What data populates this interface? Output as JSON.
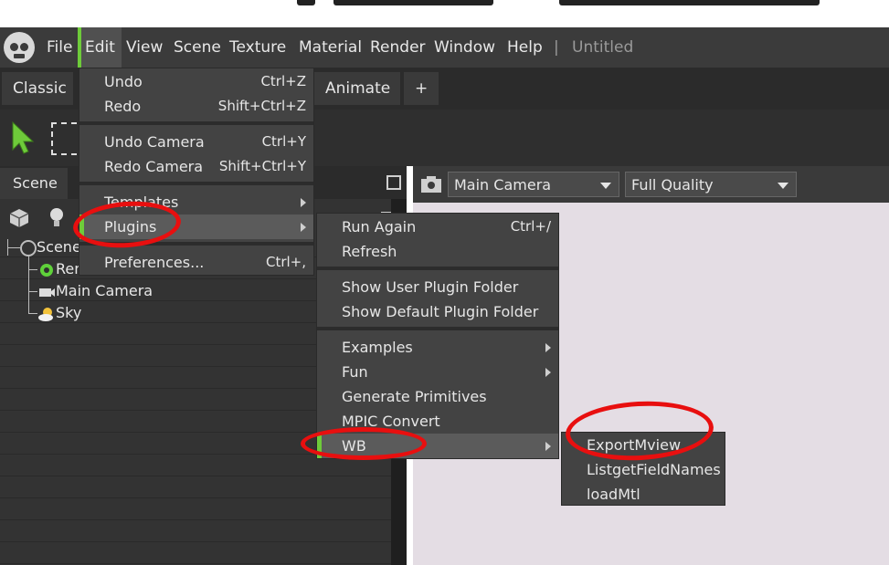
{
  "menubar": {
    "items": [
      "File",
      "Edit",
      "View",
      "Scene",
      "Texture",
      "Material",
      "Render",
      "Window",
      "Help"
    ],
    "separator": "|",
    "document_title": "Untitled"
  },
  "tabs": {
    "classic": "Classic",
    "animate": "Animate",
    "add": "+"
  },
  "scene_panel": {
    "tab": "Scene",
    "tree": [
      "Scene",
      "Render",
      "Main Camera",
      "Sky"
    ]
  },
  "viewport": {
    "camera": "Main Camera",
    "quality": "Full Quality"
  },
  "edit_menu": {
    "items": [
      {
        "label": "Undo",
        "shortcut": "Ctrl+Z"
      },
      {
        "label": "Redo",
        "shortcut": "Shift+Ctrl+Z"
      },
      {
        "label": "Undo Camera",
        "shortcut": "Ctrl+Y"
      },
      {
        "label": "Redo Camera",
        "shortcut": "Shift+Ctrl+Y"
      },
      {
        "label": "Templates",
        "shortcut": ""
      },
      {
        "label": "Plugins",
        "shortcut": ""
      },
      {
        "label": "Preferences...",
        "shortcut": "Ctrl+,"
      }
    ]
  },
  "plugins_menu": {
    "items": [
      {
        "label": "Run Again",
        "shortcut": "Ctrl+/"
      },
      {
        "label": "Refresh",
        "shortcut": ""
      },
      {
        "label": "Show User Plugin Folder",
        "shortcut": ""
      },
      {
        "label": "Show Default Plugin Folder",
        "shortcut": ""
      },
      {
        "label": "Examples",
        "shortcut": ""
      },
      {
        "label": "Fun",
        "shortcut": ""
      },
      {
        "label": "Generate Primitives",
        "shortcut": ""
      },
      {
        "label": "MPIC Convert",
        "shortcut": ""
      },
      {
        "label": "WB",
        "shortcut": ""
      }
    ]
  },
  "wb_menu": {
    "items": [
      {
        "label": "ExportMview"
      },
      {
        "label": "ListgetFieldNames"
      },
      {
        "label": "loadMtl"
      }
    ]
  },
  "colors": {
    "accent": "#6ecb3a",
    "annotation": "#e80f0f",
    "viewport_bg": "#e4dde4"
  },
  "icons": [
    "toolbag-logo-icon",
    "select-arrow-icon",
    "rect-select-icon",
    "popout-icon",
    "camera-icon",
    "cube-icon",
    "light-icon",
    "trash-icon",
    "render-gear-icon",
    "camera-tree-icon",
    "sky-icon",
    "scene-root-icon"
  ]
}
